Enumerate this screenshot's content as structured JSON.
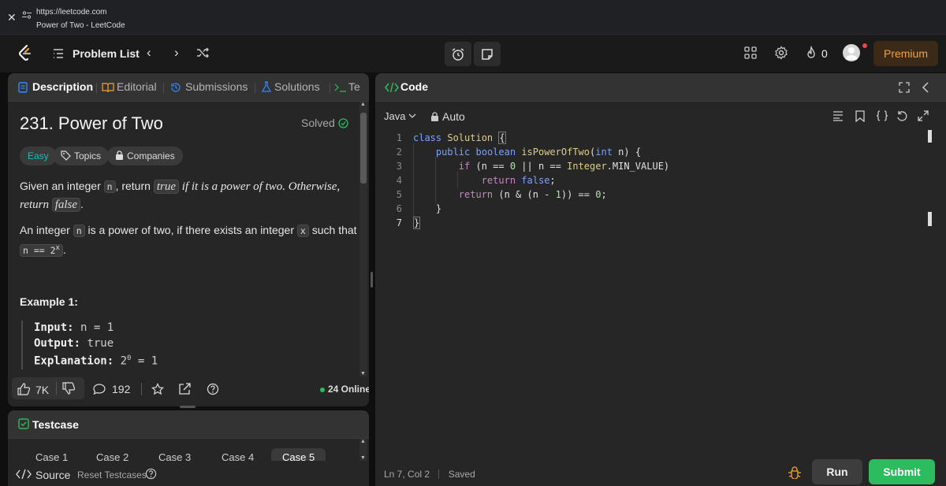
{
  "browser": {
    "url": "https://leetcode.com",
    "page_title": "Power of Two - LeetCode"
  },
  "nav": {
    "problem_list": "Problem List",
    "streak_count": "0",
    "premium": "Premium"
  },
  "left_tabs": [
    "Description",
    "Editorial",
    "Submissions",
    "Solutions",
    "Te"
  ],
  "problem": {
    "title": "231. Power of Two",
    "status": "Solved",
    "difficulty": "Easy",
    "topics": "Topics",
    "companies": "Companies",
    "p1": {
      "a": "Given an integer ",
      "code_n": "n",
      "b": ", return ",
      "code_true": "true",
      "c": " if it is a power of two. Otherwise,",
      "d": "return ",
      "code_false": "false",
      "e": "."
    },
    "p2": {
      "a": "An integer ",
      "code_n": "n",
      "b": " is a power of two, if there exists an integer ",
      "code_x": "x",
      "c": " such that",
      "expr": "n == 2",
      "sup": "x",
      "d": "."
    },
    "example_title": "Example 1:",
    "example": {
      "input_label": "Input:",
      "input_value": " n = 1",
      "output_label": "Output:",
      "output_value": " true",
      "expl_label": "Explanation:",
      "expl_value": " 2",
      "expl_sup": "0",
      "expl_rest": " = 1"
    }
  },
  "footer": {
    "likes": "7K",
    "comments": "192",
    "online": "24 Online"
  },
  "testcase": {
    "title": "Testcase",
    "cases": [
      "Case 1",
      "Case 2",
      "Case 3",
      "Case 4",
      "Case 5"
    ],
    "source": "Source",
    "reset": "Reset Testcases"
  },
  "code": {
    "title": "Code",
    "language": "Java",
    "mode": "Auto",
    "line_numbers": [
      "1",
      "2",
      "3",
      "4",
      "5",
      "6",
      "7"
    ],
    "status_pos": "Ln 7, Col 2",
    "status_saved": "Saved",
    "run": "Run",
    "submit": "Submit"
  },
  "colors": {
    "accent_green": "#2cbb5d",
    "easy_teal": "#1cbaba",
    "premium_orange": "#f3a343"
  }
}
